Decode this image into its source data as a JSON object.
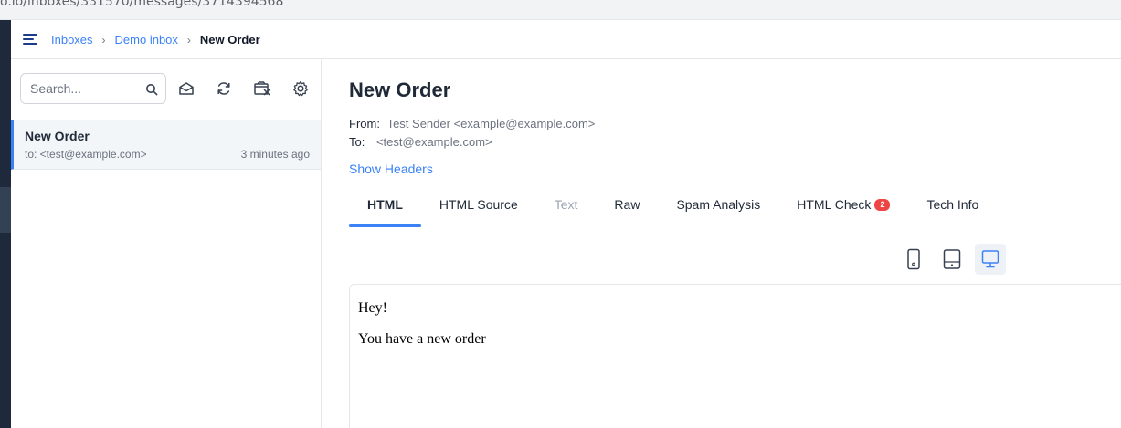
{
  "browser": {
    "url_text": "o.io/inboxes/331570/messages/3714394568"
  },
  "topbar": {
    "breadcrumb": [
      {
        "label": "Inboxes"
      },
      {
        "label": "Demo inbox"
      }
    ],
    "current": "New Order",
    "separator": "›"
  },
  "sidebar": {
    "search": {
      "placeholder": "Search...",
      "value": ""
    },
    "toolbar_icons": [
      "mark-read-icon",
      "refresh-icon",
      "clear-inbox-icon",
      "settings-icon"
    ],
    "messages": [
      {
        "subject": "New Order",
        "to": "to: <test@example.com>",
        "time": "3 minutes ago"
      }
    ]
  },
  "message": {
    "subject": "New Order",
    "from_label": "From:",
    "from_value": "Test Sender <example@example.com>",
    "to_label": "To:",
    "to_value": "<test@example.com>",
    "show_headers": "Show Headers",
    "tabs": [
      {
        "label": "HTML",
        "state": "active"
      },
      {
        "label": "HTML Source",
        "state": "normal"
      },
      {
        "label": "Text",
        "state": "disabled"
      },
      {
        "label": "Raw",
        "state": "normal"
      },
      {
        "label": "Spam Analysis",
        "state": "normal"
      },
      {
        "label": "HTML Check",
        "state": "normal",
        "badge": "2"
      },
      {
        "label": "Tech Info",
        "state": "normal"
      }
    ],
    "device_buttons": [
      "mobile-view-icon",
      "tablet-view-icon",
      "desktop-view-icon"
    ],
    "active_device": "desktop",
    "body_lines": [
      "Hey!",
      "You have a new order"
    ]
  },
  "colors": {
    "accent": "#3b82f6",
    "badge": "#ef4444",
    "rail": "#1e293b",
    "selected_row": "#f3f6f8"
  }
}
